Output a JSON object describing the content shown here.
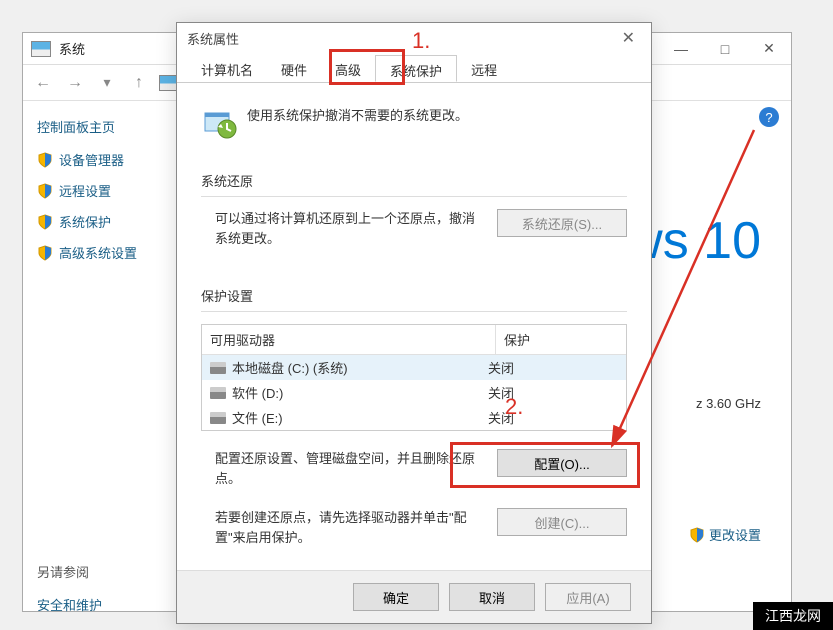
{
  "bg_window": {
    "title": "系统",
    "controls": {
      "min": "—",
      "max": "□",
      "close": "✕"
    },
    "nav": {
      "back": "←",
      "forward": "→",
      "up": "↑"
    },
    "sidebar": {
      "header": "控制面板主页",
      "items": [
        "设备管理器",
        "远程设置",
        "系统保护",
        "高级系统设置"
      ],
      "footer_header": "另请参阅",
      "footer_item": "安全和维护"
    },
    "right_text": "ws 10",
    "info": "z   3.60 GHz",
    "link": "更改设置",
    "help": "?"
  },
  "dialog": {
    "title": "系统属性",
    "close": "✕",
    "tabs": [
      "计算机名",
      "硬件",
      "高级",
      "系统保护",
      "远程"
    ],
    "active_tab": 3,
    "intro": "使用系统保护撤消不需要的系统更改。",
    "section_restore": {
      "label": "系统还原",
      "text": "可以通过将计算机还原到上一个还原点，撤消系统更改。",
      "button": "系统还原(S)..."
    },
    "section_protect": {
      "label": "保护设置",
      "headers": {
        "drive": "可用驱动器",
        "protection": "保护"
      },
      "drives": [
        {
          "name": "本地磁盘 (C:) (系统)",
          "status": "关闭",
          "selected": true
        },
        {
          "name": "软件 (D:)",
          "status": "关闭",
          "selected": false
        },
        {
          "name": "文件 (E:)",
          "status": "关闭",
          "selected": false
        }
      ],
      "config_text": "配置还原设置、管理磁盘空间，并且删除还原点。",
      "config_button": "配置(O)...",
      "create_text": "若要创建还原点，请先选择驱动器并单击\"配置\"来启用保护。",
      "create_button": "创建(C)..."
    },
    "footer": {
      "ok": "确定",
      "cancel": "取消",
      "apply": "应用(A)"
    }
  },
  "annotations": {
    "num1": "1.",
    "num2": "2."
  },
  "watermark": "江西龙网"
}
